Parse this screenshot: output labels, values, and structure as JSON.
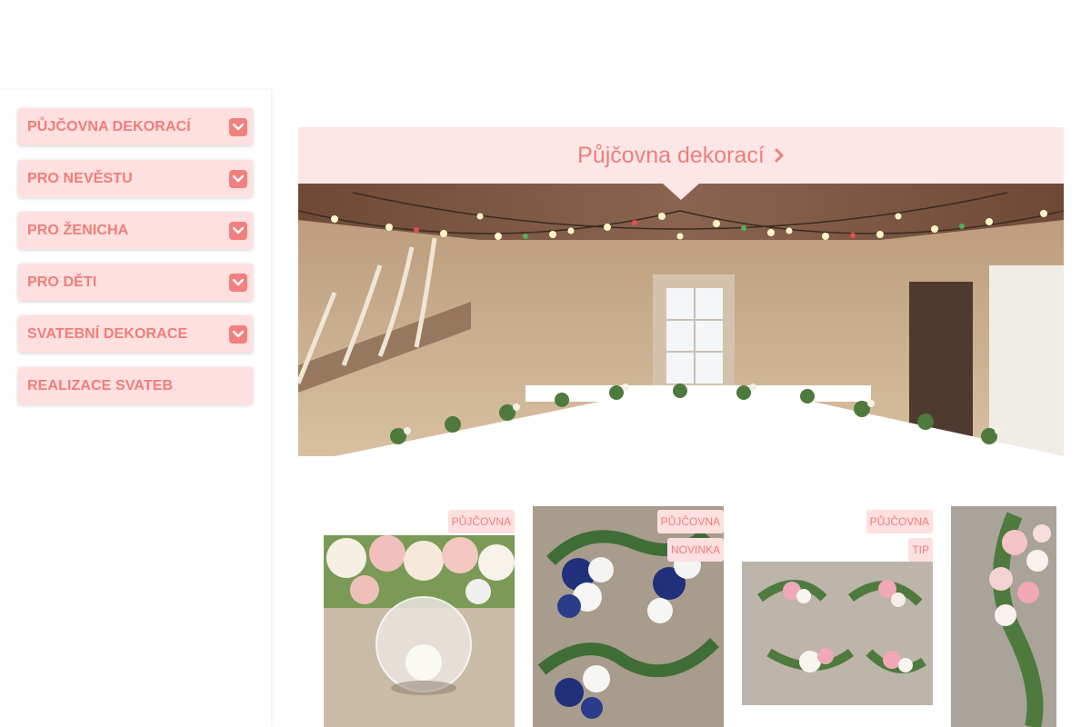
{
  "sidebar": {
    "items": [
      {
        "label": "PŮJČOVNA DEKORACÍ",
        "has_toggle": true
      },
      {
        "label": "PRO NEVĚSTU",
        "has_toggle": true
      },
      {
        "label": "PRO ŽENICHA",
        "has_toggle": true
      },
      {
        "label": "PRO DĚTI",
        "has_toggle": true
      },
      {
        "label": "SVATEBNÍ DEKORACE",
        "has_toggle": true
      },
      {
        "label": "REALIZACE SVATEB",
        "has_toggle": false
      }
    ]
  },
  "banner": {
    "title": "Půjčovna dekorací",
    "chevron_icon": "chevron-right-icon"
  },
  "products": [
    {
      "badges": [
        "PŮJČOVNA"
      ],
      "image": "glass-globe-rose"
    },
    {
      "badges": [
        "PŮJČOVNA",
        "NOVINKA"
      ],
      "image": "blue-white-arrangements"
    },
    {
      "badges": [
        "PŮJČOVNA",
        "TIP"
      ],
      "image": "pink-white-arrangements"
    },
    {
      "badges": [],
      "image": "rose-garland"
    }
  ],
  "colors": {
    "accent": "#f07d7a",
    "menu_bg": "#fde0df",
    "banner_bg": "#fde7e6",
    "toggle_bg": "#f2807f"
  }
}
